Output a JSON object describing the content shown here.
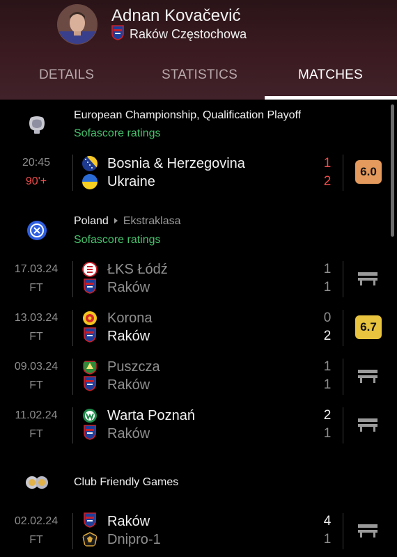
{
  "player": {
    "name": "Adnan Kovačević",
    "team": "Raków Częstochowa"
  },
  "tabs": [
    {
      "label": "DETAILS",
      "active": false
    },
    {
      "label": "STATISTICS",
      "active": false
    },
    {
      "label": "MATCHES",
      "active": true
    }
  ],
  "colors": {
    "accent_green": "#46c26c",
    "live_red": "#ef4b4b",
    "rating_orange": "#e49a5c",
    "rating_yellow": "#e8c43f"
  },
  "sections": [
    {
      "title": "European Championship, Qualification Playoff",
      "subtitle": "Sofascore ratings",
      "icon": "euro-trophy-icon",
      "matches": [
        {
          "date": "20:45",
          "status": "90'+",
          "live": true,
          "home": "Bosnia & Herzegovina",
          "away": "Ukraine",
          "home_score": "1",
          "away_score": "2",
          "rating": "6.0"
        }
      ]
    },
    {
      "country": "Poland",
      "league": "Ekstraklasa",
      "subtitle": "Sofascore ratings",
      "icon": "ekstraklasa-icon",
      "matches": [
        {
          "date": "17.03.24",
          "status": "FT",
          "home": "ŁKS Łódź",
          "away": "Raków",
          "home_score": "1",
          "away_score": "1",
          "bench": true
        },
        {
          "date": "13.03.24",
          "status": "FT",
          "home": "Korona",
          "away": "Raków",
          "home_score": "0",
          "away_score": "2",
          "rating": "6.7"
        },
        {
          "date": "09.03.24",
          "status": "FT",
          "home": "Puszcza",
          "away": "Raków",
          "home_score": "1",
          "away_score": "1",
          "bench": true
        },
        {
          "date": "11.02.24",
          "status": "FT",
          "home": "Warta Poznań",
          "away": "Raków",
          "home_score": "2",
          "away_score": "1",
          "bench": true
        }
      ]
    },
    {
      "title": "Club Friendly Games",
      "icon": "club-friendly-icon",
      "matches": [
        {
          "date": "02.02.24",
          "status": "FT",
          "home": "Raków",
          "away": "Dnipro-1",
          "home_score": "4",
          "away_score": "1",
          "bench": true
        }
      ]
    }
  ]
}
